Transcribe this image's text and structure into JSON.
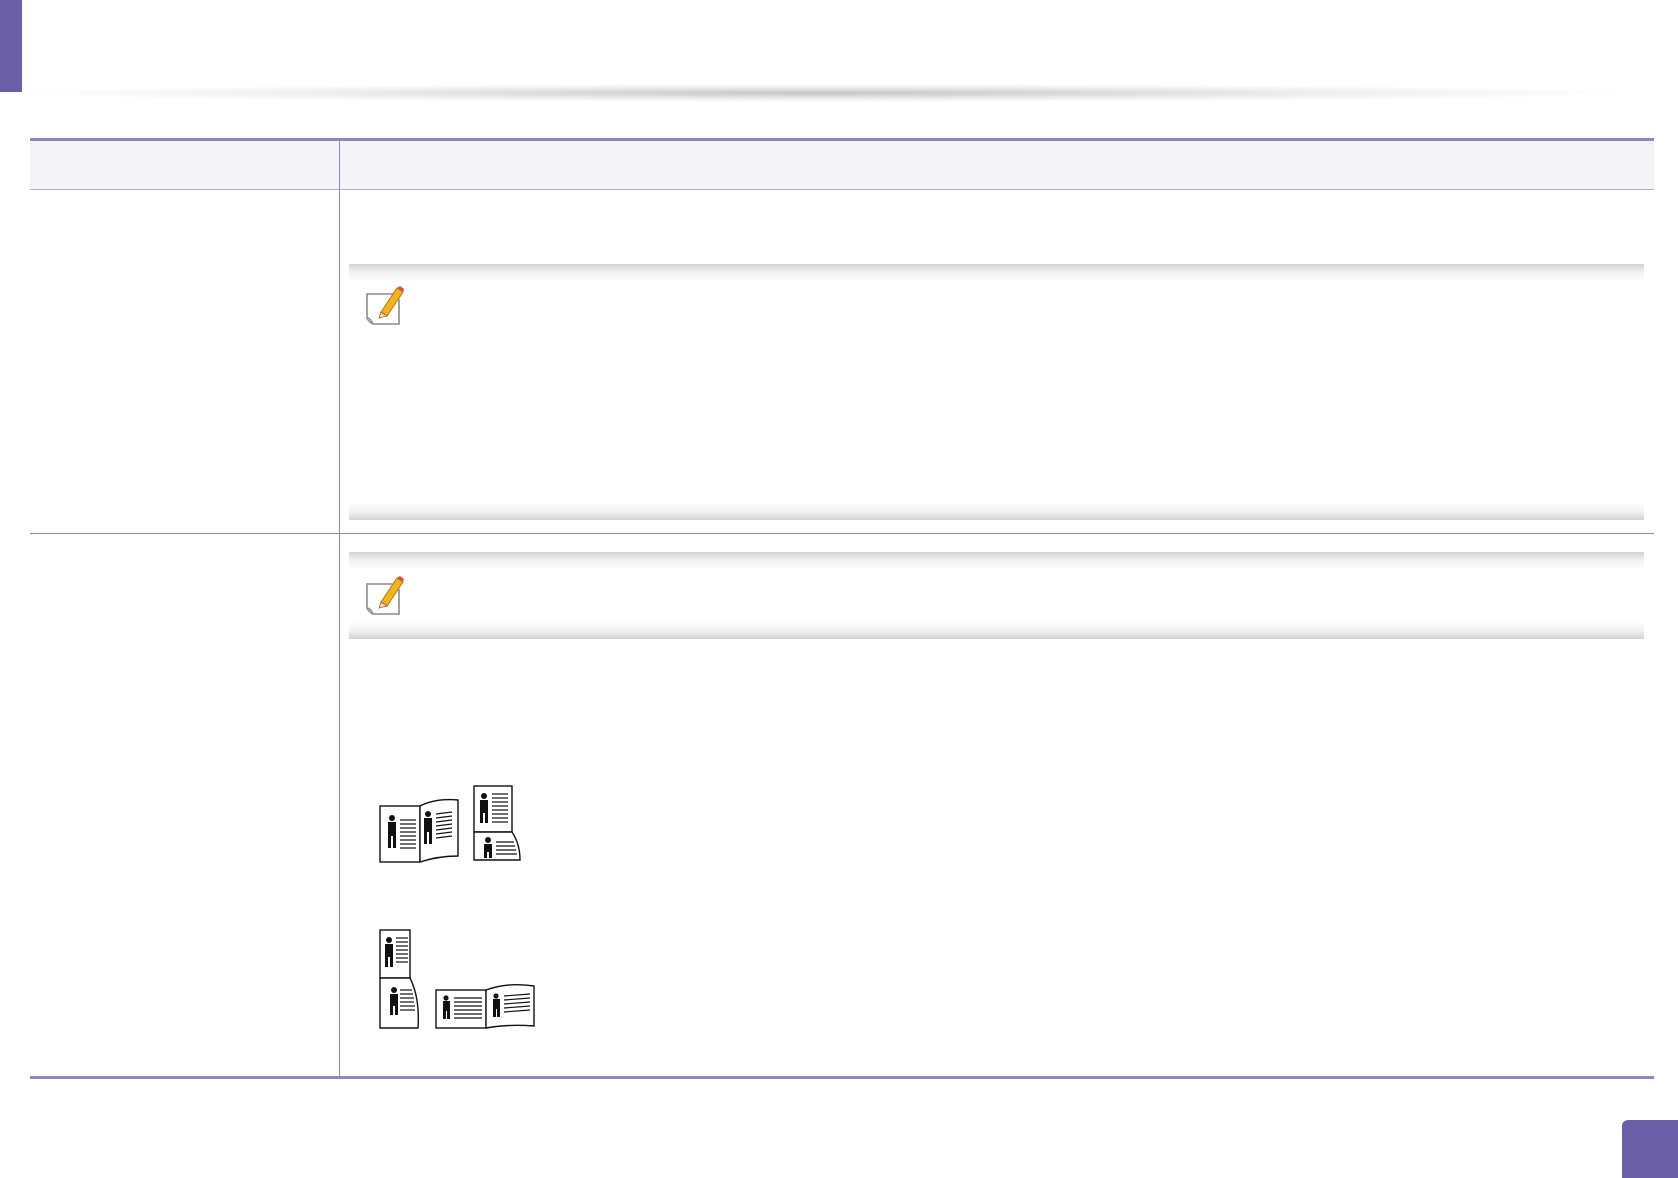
{
  "page": {
    "accent_color": "#6b5fa8",
    "rule_color": "#8f86c3",
    "note_icon": "note-pencil-icon"
  },
  "table": {
    "header": {
      "col1": "",
      "col2": ""
    },
    "rows": [
      {
        "option": "",
        "notes": [
          {
            "icon": "note-pencil-icon",
            "text": ""
          }
        ]
      },
      {
        "option": "",
        "notes": [
          {
            "icon": "note-pencil-icon",
            "text": ""
          }
        ],
        "illustrations": [
          "duplex-long-edge-illustration",
          "duplex-short-edge-illustration"
        ]
      }
    ]
  },
  "footer": {
    "page_number": ""
  }
}
